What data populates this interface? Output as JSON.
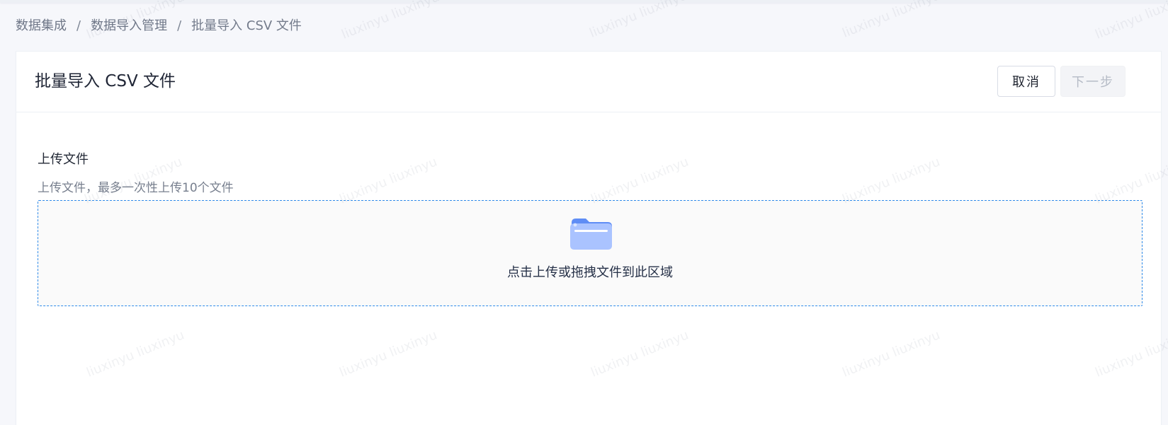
{
  "breadcrumb": {
    "items": [
      "数据集成",
      "数据导入管理",
      "批量导入 CSV 文件"
    ],
    "separator": "/"
  },
  "header": {
    "title": "批量导入 CSV 文件",
    "cancel_label": "取消",
    "next_label": "下一步"
  },
  "upload": {
    "section_title": "上传文件",
    "description": "上传文件，最多一次性上传10个文件",
    "dropzone_text": "点击上传或拖拽文件到此区域",
    "icon": "folder-icon"
  },
  "watermark": {
    "text": "liuxinyu liuxinyu"
  },
  "colors": {
    "accent": "#2f8be9",
    "page_background": "#f6f7fb",
    "card_background": "#ffffff",
    "disabled_button_text": "#b5bbc6"
  }
}
